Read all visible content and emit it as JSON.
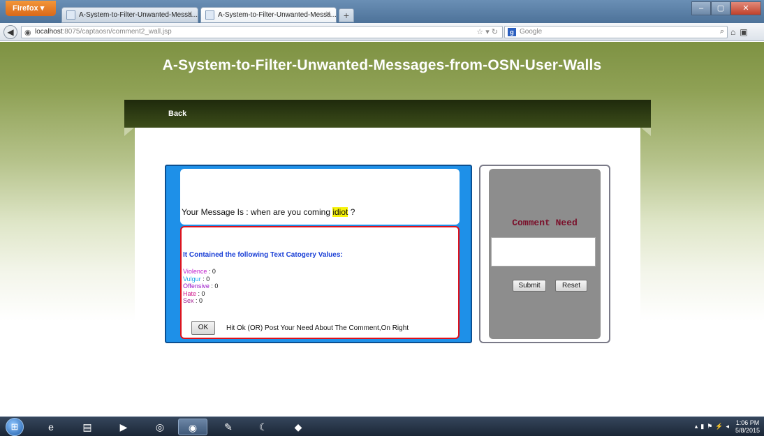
{
  "browser": {
    "menu_label": "Firefox",
    "tabs": [
      {
        "title": "A-System-to-Filter-Unwanted-Messa...",
        "active": false
      },
      {
        "title": "A-System-to-Filter-Unwanted-Messa...",
        "active": true
      }
    ],
    "new_tab_symbol": "+",
    "url_host": "localhost",
    "url_path": ":8075/captaosn/comment2_wall.jsp",
    "search_placeholder": "Google",
    "window_buttons": {
      "minimize": "–",
      "maximize": "▢",
      "close": "✕"
    }
  },
  "page": {
    "site_title": "A-System-to-Filter-Unwanted-Messages-from-OSN-User-Walls",
    "nav_back": "Back",
    "message": {
      "prefix": "Your Message Is : when are you coming ",
      "flagged_word": "idiot",
      "suffix": " ?"
    },
    "categories": {
      "heading": "It Contained the following Text Catogery Values:",
      "items": [
        {
          "label": "Violence",
          "value": " : 0",
          "color": "#c01ccb"
        },
        {
          "label": "Vulgur",
          "value": " : 0",
          "color": "#1aa4e8"
        },
        {
          "label": "Offensive",
          "value": " : 0",
          "color": "#9a16c8"
        },
        {
          "label": "Hate",
          "value": " : 0",
          "color": "#d0168a"
        },
        {
          "label": "Sex",
          "value": " : 0",
          "color": "#a0188e"
        }
      ]
    },
    "ok_button": "OK",
    "hint": "Hit Ok (OR) Post Your Need About The Comment,On Right",
    "comment_panel": {
      "title": "Comment Need",
      "textarea_value": "",
      "submit": "Submit",
      "reset": "Reset"
    }
  },
  "taskbar": {
    "time": "1:06 PM",
    "date": "5/8/2015"
  },
  "colors": {
    "header_olive": "#7e9243",
    "nav_band": "#2e3b13",
    "message_panel_blue": "#1e90e8",
    "flag_highlight": "#f6f20a",
    "category_heading": "#1a3fd6",
    "comment_title": "#7a0f2a"
  }
}
